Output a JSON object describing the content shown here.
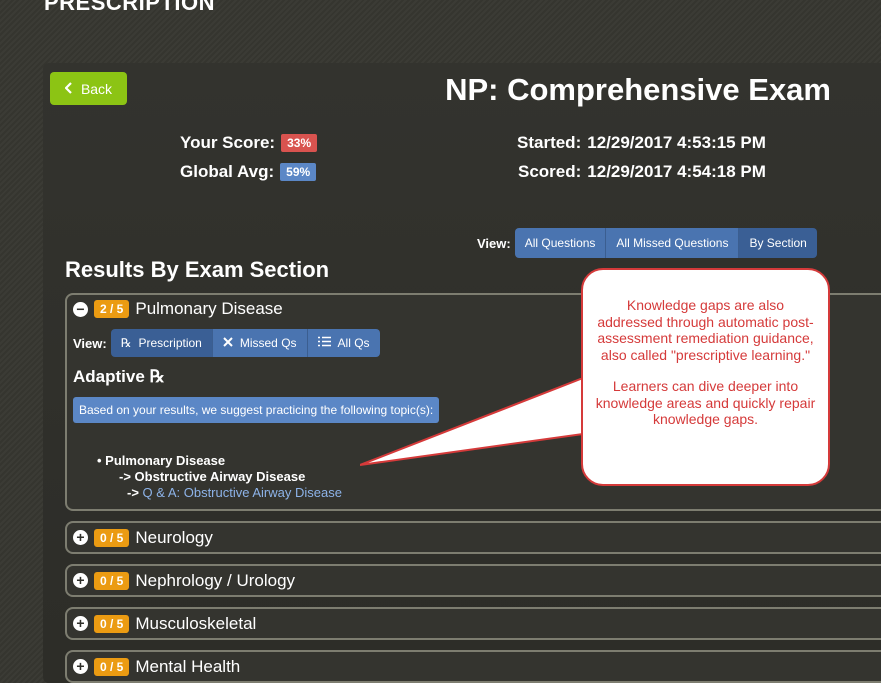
{
  "header": {
    "title": "PRESCRIPTION"
  },
  "back_button": {
    "label": "Back"
  },
  "exam": {
    "title": "NP: Comprehensive Exam"
  },
  "scores": {
    "your_score_label": "Your Score:",
    "your_score": "33%",
    "global_avg_label": "Global Avg:",
    "global_avg": "59%",
    "started_label": "Started:",
    "started": "12/29/2017 4:53:15 PM",
    "scored_label": "Scored:",
    "scored": "12/29/2017 4:54:18 PM"
  },
  "view": {
    "label": "View:",
    "options": [
      "All Questions",
      "All Missed Questions",
      "By Section"
    ],
    "selected": "By Section"
  },
  "results_heading": "Results By Exam Section",
  "sections": [
    {
      "score": "2 / 5",
      "title": "Pulmonary Disease",
      "expanded": true,
      "sub_view_label": "View:",
      "sub_view_options": [
        "Prescription",
        "Missed Qs",
        "All Qs"
      ],
      "adaptive_label": "Adaptive ℞",
      "suggest_text": "Based on your results, we suggest practicing the following topic(s):",
      "topic": "Pulmonary Disease",
      "subtopic": "-> Obstructive Airway Disease",
      "link_prefix": "->",
      "link": "Q & A: Obstructive Airway Disease"
    },
    {
      "score": "0 / 5",
      "title": "Neurology",
      "expanded": false
    },
    {
      "score": "0 / 5",
      "title": "Nephrology / Urology",
      "expanded": false
    },
    {
      "score": "0 / 5",
      "title": "Musculoskeletal",
      "expanded": false
    },
    {
      "score": "0 / 5",
      "title": "Mental Health",
      "expanded": false
    }
  ],
  "callout": {
    "paragraph1": "Knowledge gaps are also addressed through automatic post-assessment remediation guidance, also called \"prescriptive learning.\"",
    "paragraph2": "Learners can dive deeper into knowledge areas and quickly repair knowledge gaps."
  },
  "colors": {
    "back_green": "#8cc414",
    "score_red": "#d9534f",
    "avg_blue": "#5b87c6",
    "section_orange": "#eb9b12",
    "callout_red": "#d53a3a"
  }
}
